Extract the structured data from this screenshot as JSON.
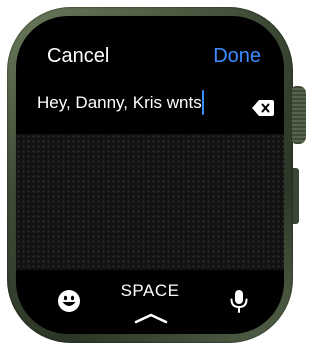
{
  "header": {
    "cancel_label": "Cancel",
    "done_label": "Done"
  },
  "input": {
    "text": "Hey, Danny, Kris wnts"
  },
  "keyboard": {
    "space_label": "SPACE"
  },
  "icons": {
    "delete": "delete-backspace-icon",
    "emoji": "emoji-icon",
    "microphone": "microphone-icon",
    "chevron": "chevron-up-icon"
  },
  "colors": {
    "accent": "#3c8cff",
    "case": "#3d4a35",
    "screen": "#000000",
    "text": "#ffffff"
  }
}
